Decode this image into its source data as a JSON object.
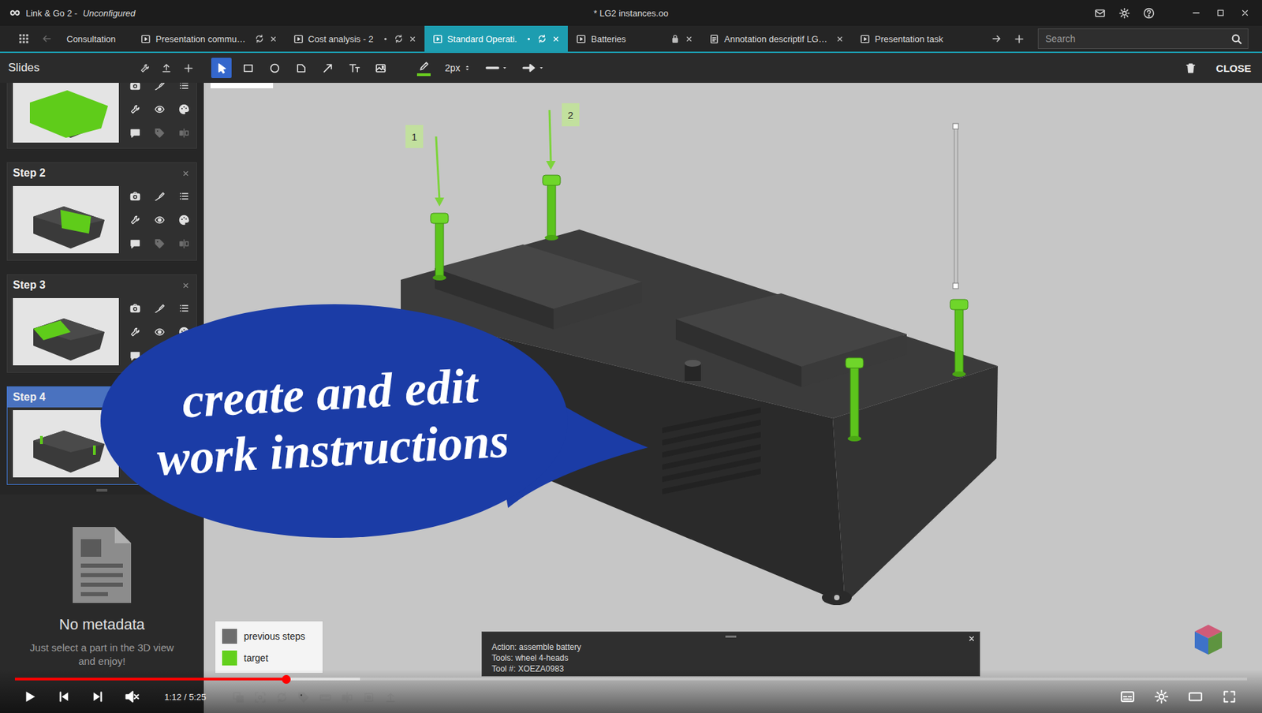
{
  "window": {
    "app": "Link & Go 2 -",
    "config": "Unconfigured",
    "document": "* LG2 instances.oo"
  },
  "tabs": [
    {
      "label": "Consultation",
      "kind": "plain",
      "selected": false,
      "modified": false,
      "synced": false,
      "locked": false,
      "closable": false
    },
    {
      "label": "Presentation commu…",
      "kind": "slides",
      "selected": false,
      "modified": false,
      "synced": true,
      "locked": false,
      "closable": true
    },
    {
      "label": "Cost analysis - 2",
      "kind": "slides",
      "selected": false,
      "modified": true,
      "synced": true,
      "locked": false,
      "closable": true
    },
    {
      "label": "Standard Operati.",
      "kind": "slides",
      "selected": true,
      "modified": true,
      "synced": true,
      "locked": false,
      "closable": true
    },
    {
      "label": "Batteries",
      "kind": "slides",
      "selected": false,
      "modified": false,
      "synced": false,
      "locked": true,
      "closable": true
    },
    {
      "label": "Annotation descriptif LG…",
      "kind": "doc",
      "selected": false,
      "modified": false,
      "synced": false,
      "locked": false,
      "closable": true
    },
    {
      "label": "Presentation task",
      "kind": "slides",
      "selected": false,
      "modified": false,
      "synced": false,
      "locked": false,
      "closable": false
    }
  ],
  "search": {
    "placeholder": "Search"
  },
  "slides": {
    "title": "Slides",
    "tools": [
      {
        "kind": "camera",
        "disabled": false
      },
      {
        "kind": "pen-curve",
        "disabled": false
      },
      {
        "kind": "list",
        "disabled": false
      },
      {
        "kind": "wrench",
        "disabled": false
      },
      {
        "kind": "eye",
        "disabled": false
      },
      {
        "kind": "palette",
        "disabled": false
      },
      {
        "kind": "comment",
        "disabled": false
      },
      {
        "kind": "tag",
        "disabled": true
      },
      {
        "kind": "split",
        "disabled": true
      }
    ],
    "items": [
      {
        "kind": "partial",
        "selected": false
      },
      {
        "kind": "full",
        "label": "Step 2",
        "selected": false
      },
      {
        "kind": "full",
        "label": "Step 3",
        "selected": false
      },
      {
        "kind": "full",
        "label": "Step 4",
        "selected": true
      }
    ]
  },
  "metadata": {
    "title": "No metadata",
    "hint": "Just select a part in the 3D view and enjoy!"
  },
  "toolbar": {
    "tools": [
      {
        "kind": "select",
        "selected": true
      },
      {
        "kind": "rect",
        "selected": false
      },
      {
        "kind": "circle",
        "selected": false
      },
      {
        "kind": "polygon",
        "selected": false
      },
      {
        "kind": "arrow",
        "selected": false
      },
      {
        "kind": "text",
        "selected": false
      },
      {
        "kind": "image",
        "selected": false
      }
    ],
    "stroke_color": "#6bd11f",
    "stroke_width": "2px",
    "close": "CLOSE"
  },
  "viewport": {
    "labels": [
      "1",
      "2"
    ],
    "legend": [
      {
        "label": "previous steps",
        "color": "#6d6d6d"
      },
      {
        "label": "target",
        "color": "#63d01c"
      }
    ],
    "info": [
      "Action: assemble battery",
      "Tools: wheel 4-heads",
      "Tool #: XOEZA0983"
    ]
  },
  "overlay": {
    "lines": [
      "create and edit",
      "work instructions"
    ]
  },
  "player": {
    "time": "1:12 / 5:25",
    "level": 0.22,
    "buffered": 0.28,
    "playing": false,
    "muted": true
  }
}
